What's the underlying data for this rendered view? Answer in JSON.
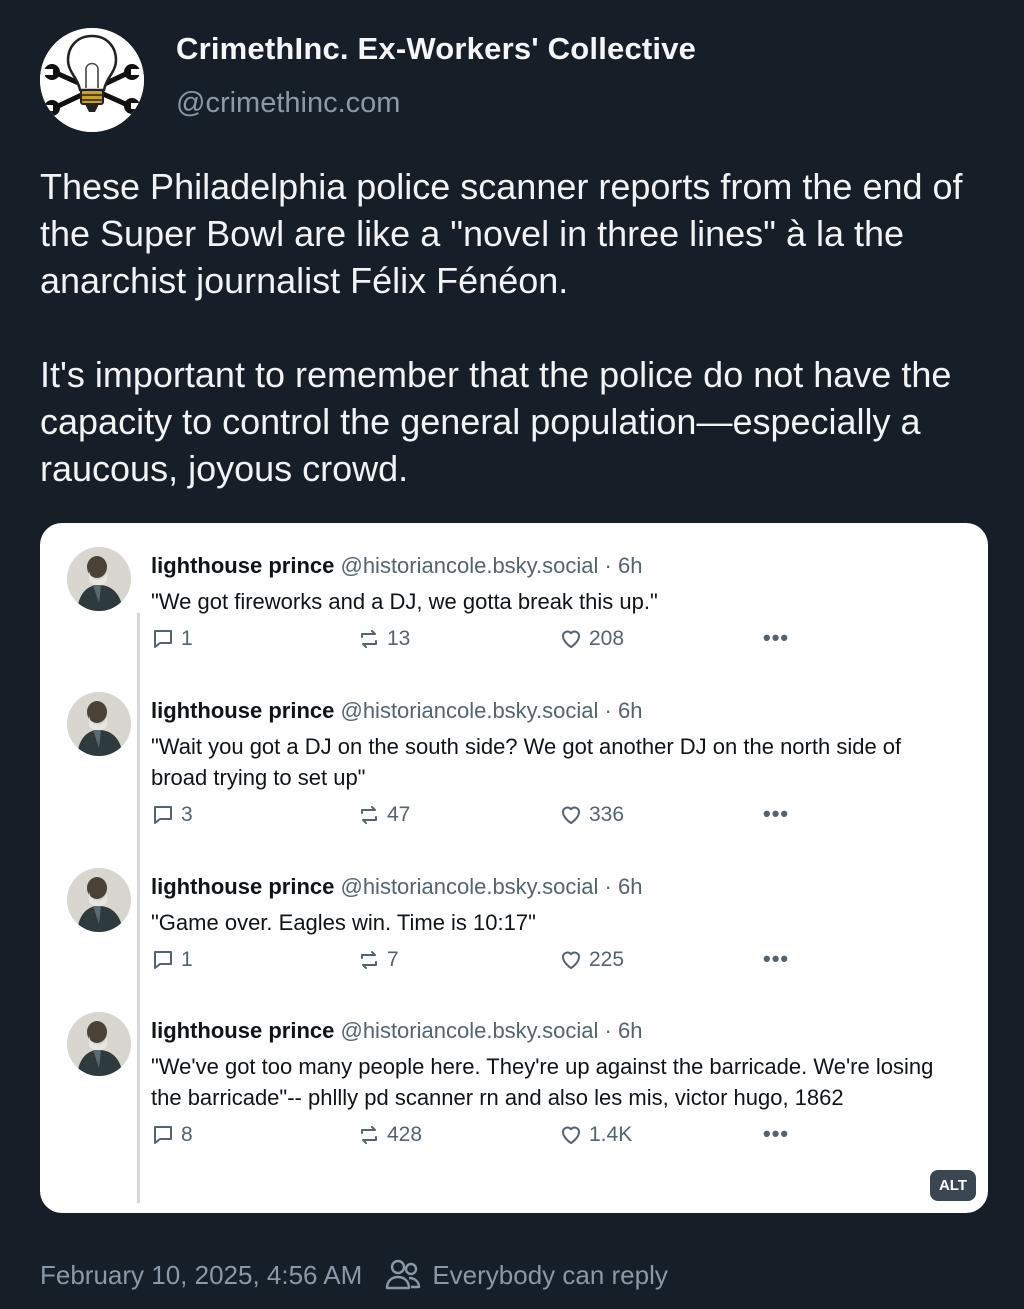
{
  "post": {
    "author_name": "CrimethInc. Ex-Workers' Collective",
    "author_handle": "@crimethinc.com",
    "avatar_icon": "lightbulb-wrench-logo-icon",
    "paragraphs": [
      "These Philadelphia police scanner reports from the end of the Super Bowl are like a \"novel in three lines\" à la the anarchist journalist Félix Fénéon.",
      "It's important to remember that the police do not have the capacity to control the general population—especially a raucous, joyous crowd."
    ],
    "timestamp": "February 10, 2025, 4:56 AM",
    "reply_setting": "Everybody can reply",
    "reply_setting_icon": "people-icon"
  },
  "embed": {
    "alt_label": "ALT",
    "tweets": [
      {
        "name": "lighthouse prince",
        "handle_time": "@historiancole.bsky.social · 6h",
        "text": "\"We got fireworks and a DJ, we gotta break this up.\"",
        "replies": "1",
        "reposts": "13",
        "likes": "208",
        "more": "•••"
      },
      {
        "name": "lighthouse prince",
        "handle_time": "@historiancole.bsky.social · 6h",
        "text": "\"Wait you got a DJ on the south side? We got another DJ on the north side of broad trying to set up\"",
        "replies": "3",
        "reposts": "47",
        "likes": "336",
        "more": "•••"
      },
      {
        "name": "lighthouse prince",
        "handle_time": "@historiancole.bsky.social · 6h",
        "text": "\"Game over. Eagles win. Time is 10:17\"",
        "replies": "1",
        "reposts": "7",
        "likes": "225",
        "more": "•••"
      },
      {
        "name": "lighthouse prince",
        "handle_time": "@historiancole.bsky.social · 6h",
        "text": "\"We've got too many people here. They're up against the barricade. We're losing the barricade\"-- phllly pd scanner rn and also les mis, victor hugo, 1862",
        "replies": "8",
        "reposts": "428",
        "likes": "1.4K",
        "more": "•••"
      }
    ]
  },
  "colors": {
    "background": "#161e27",
    "card": "#ffffff",
    "muted_text": "#8b98a6",
    "tweet_muted": "#536471"
  }
}
